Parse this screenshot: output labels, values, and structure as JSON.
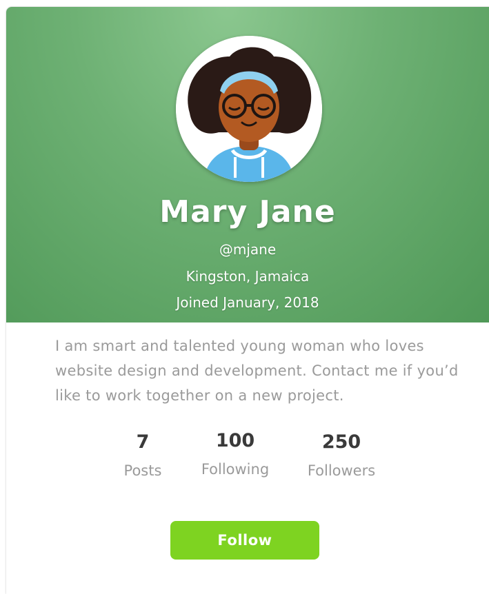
{
  "profile": {
    "name": "Mary Jane",
    "handle": "@mjane",
    "location": "Kingston, Jamaica",
    "joined": "Joined January, 2018",
    "bio": "I am smart and talented young woman who loves website design and development. Contact me if you’d like to work together on a new project.",
    "avatar_icon": "avatar-illustration"
  },
  "stats": [
    {
      "value": "7",
      "label": "Posts"
    },
    {
      "value": "100",
      "label": "Following"
    },
    {
      "value": "250",
      "label": "Followers"
    }
  ],
  "actions": {
    "follow_label": "Follow"
  },
  "colors": {
    "header_green": "#6eb174",
    "follow_green": "#7ed321",
    "text_gray": "#9a9a9a",
    "stat_dark": "#3a3a3a"
  }
}
